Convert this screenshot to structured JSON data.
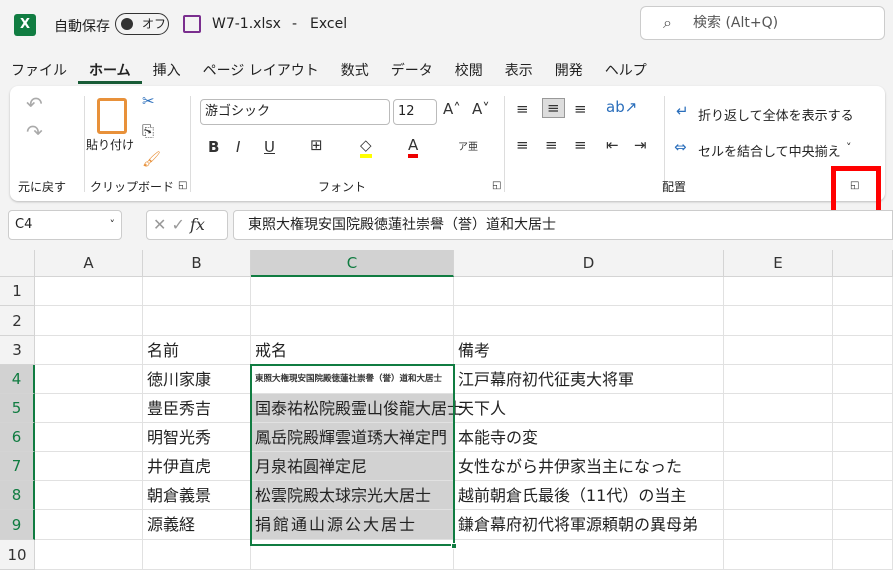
{
  "titlebar": {
    "autosave": "自動保存",
    "toggle": "オフ",
    "filename": "W7-1.xlsx",
    "sep": "-",
    "app": "Excel",
    "search": "検索 (Alt+Q)"
  },
  "tabs": [
    "ファイル",
    "ホーム",
    "挿入",
    "ページ レイアウト",
    "数式",
    "データ",
    "校閲",
    "表示",
    "開発",
    "ヘルプ"
  ],
  "ribbon": {
    "undo_group": "元に戻す",
    "paste": "貼り付け",
    "clipboard_group": "クリップボード",
    "font_name": "游ゴシック",
    "font_size": "12",
    "font_group": "フォント",
    "wrap_text": "折り返して全体を表示する",
    "merge_center": "セルを結合して中央揃え",
    "alignment_group": "配置"
  },
  "formula_bar": {
    "name_box": "C4",
    "formula": "東照大権現安国院殿徳蓮社崇譽（誉）道和大居士"
  },
  "columns": [
    "A",
    "B",
    "C",
    "D",
    "E"
  ],
  "rows": [
    "1",
    "2",
    "3",
    "4",
    "5",
    "6",
    "7",
    "8",
    "9",
    "10"
  ],
  "cells": {
    "header": {
      "b": "名前",
      "c": "戒名",
      "d": "備考"
    },
    "data": [
      {
        "b": "徳川家康",
        "c": "東照大権現安国院殿徳蓮社崇譽（誉）道和大居士",
        "d": "江戸幕府初代征夷大将軍"
      },
      {
        "b": "豊臣秀吉",
        "c": "国泰祐松院殿霊山俊龍大居士",
        "d": "天下人"
      },
      {
        "b": "明智光秀",
        "c": "鳳岳院殿輝雲道琇大禅定門",
        "d": "本能寺の変"
      },
      {
        "b": "井伊直虎",
        "c": "月泉祐圓禅定尼",
        "d": "女性ながら井伊家当主になった"
      },
      {
        "b": "朝倉義景",
        "c": "松雲院殿太球宗光大居士",
        "d": "越前朝倉氏最後（11代）の当主"
      },
      {
        "b": "源義経",
        "c": "捐館通山源公大居士",
        "d": "鎌倉幕府初代将軍源頼朝の異母弟"
      }
    ]
  }
}
